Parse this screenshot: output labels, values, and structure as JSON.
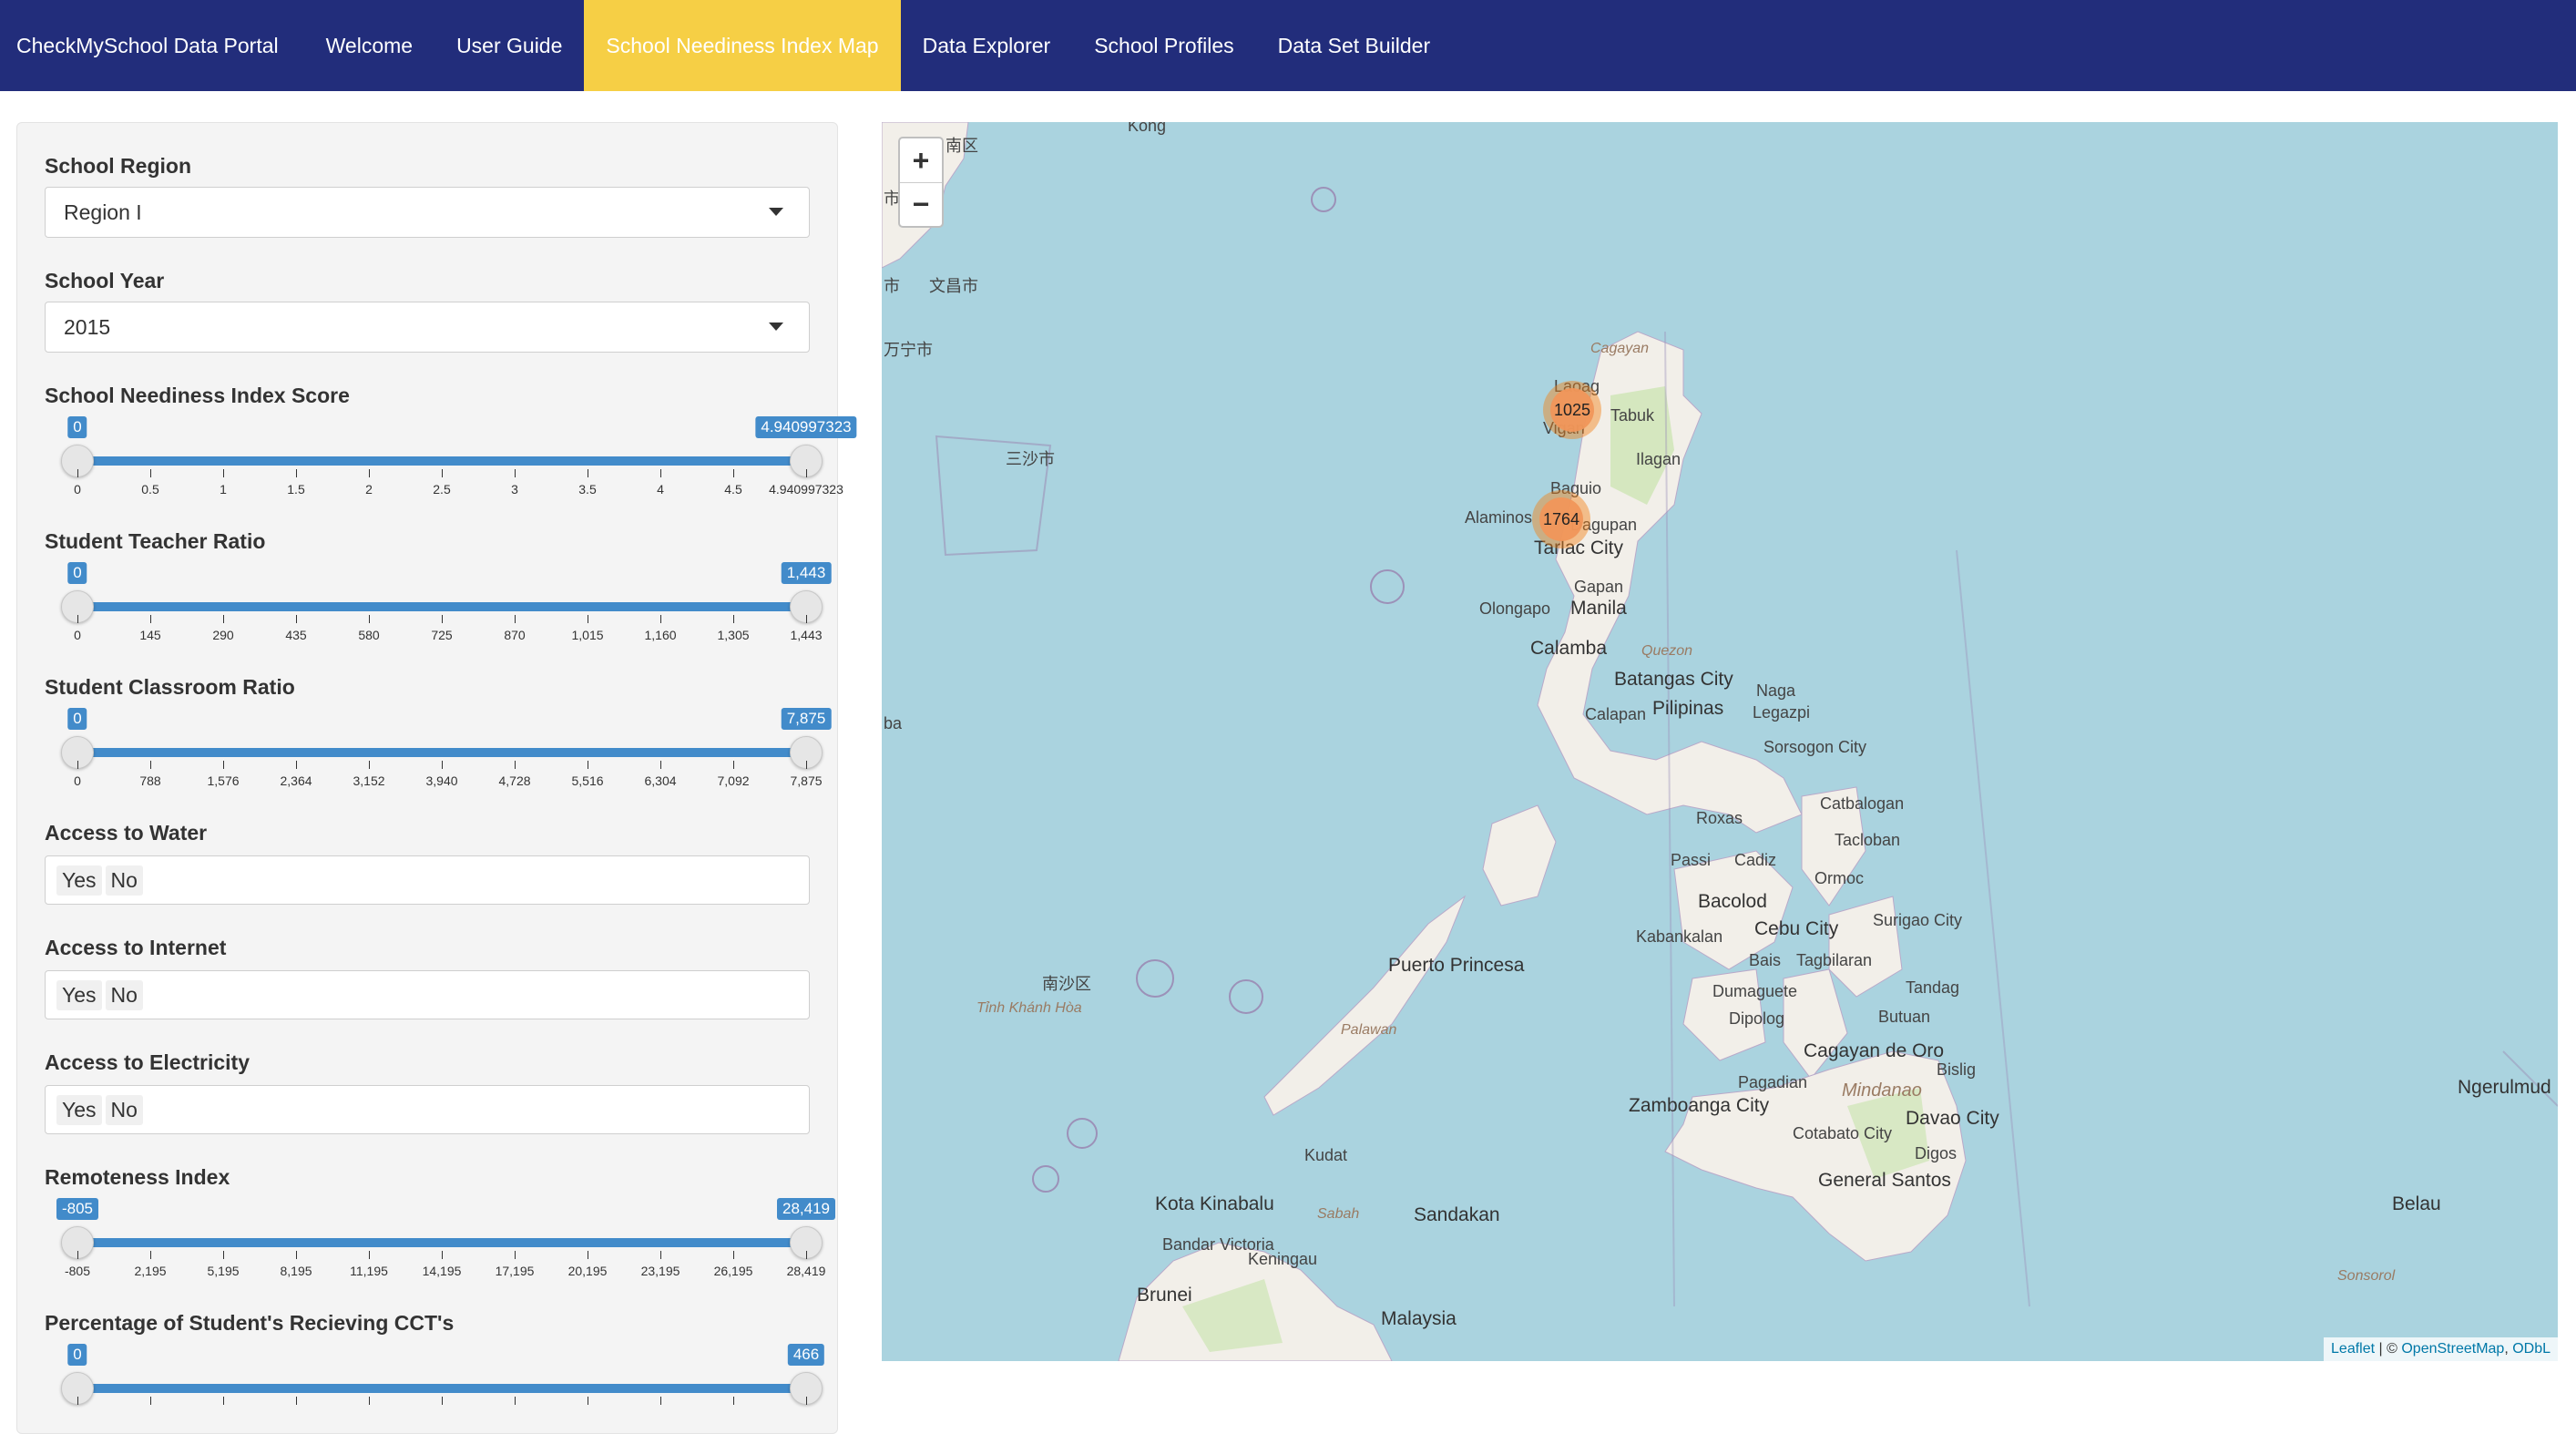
{
  "nav": {
    "brand": "CheckMySchool Data Portal",
    "tabs": [
      "Welcome",
      "User Guide",
      "School Neediness Index Map",
      "Data Explorer",
      "School Profiles",
      "Data Set Builder"
    ],
    "active_tab": "School Neediness Index Map",
    "colors": {
      "bar": "#222d7b",
      "active": "#f6cf45"
    }
  },
  "sidebar": {
    "region": {
      "label": "School Region",
      "value": "Region I"
    },
    "year": {
      "label": "School Year",
      "value": "2015"
    },
    "neediness": {
      "label": "School Neediness Index Score",
      "min": "0",
      "max": "4.940997323",
      "ticks": [
        "0",
        "0.5",
        "1",
        "1.5",
        "2",
        "2.5",
        "3",
        "3.5",
        "4",
        "4.5",
        "4.940997323"
      ]
    },
    "str": {
      "label": "Student Teacher Ratio",
      "min": "0",
      "max": "1,443",
      "ticks": [
        "0",
        "145",
        "290",
        "435",
        "580",
        "725",
        "870",
        "1,015",
        "1,160",
        "1,305",
        "1,443"
      ]
    },
    "scr": {
      "label": "Student Classroom Ratio",
      "min": "0",
      "max": "7,875",
      "ticks": [
        "0",
        "788",
        "1,576",
        "2,364",
        "3,152",
        "3,940",
        "4,728",
        "5,516",
        "6,304",
        "7,092",
        "7,875"
      ]
    },
    "water": {
      "label": "Access to Water",
      "options": [
        "Yes",
        "No"
      ]
    },
    "internet": {
      "label": "Access to Internet",
      "options": [
        "Yes",
        "No"
      ]
    },
    "electricity": {
      "label": "Access to Electricity",
      "options": [
        "Yes",
        "No"
      ]
    },
    "remoteness": {
      "label": "Remoteness Index",
      "min": "-805",
      "max": "28,419",
      "ticks": [
        "-805",
        "2,195",
        "5,195",
        "8,195",
        "11,195",
        "14,195",
        "17,195",
        "20,195",
        "23,195",
        "26,195",
        "28,419"
      ]
    },
    "cct": {
      "label": "Percentage of Student's Recieving CCT's",
      "min": "0",
      "max": "466"
    }
  },
  "map": {
    "zoom_in": "+",
    "zoom_out": "−",
    "clusters": [
      "1025",
      "1764"
    ],
    "places": {
      "kong": "Kong",
      "nanqu": "南区",
      "wenchang": "文昌市",
      "shi": "市",
      "shi2": "市",
      "wanning": "万宁市",
      "sansha": "三沙市",
      "cagayan": "Cagayan",
      "laoag": "Laoag",
      "vigan": "Vigan",
      "tabuk": "Tabuk",
      "ilagan": "Ilagan",
      "baguio": "Baguio",
      "alaminos": "Alaminos",
      "dagupan": "Dagupan",
      "tarlac": "Tarlac City",
      "gapan": "Gapan",
      "olongapo": "Olongapo",
      "manila": "Manila",
      "calamba": "Calamba",
      "quezon": "Quezon",
      "batangas": "Batangas City",
      "naga": "Naga",
      "legazpi": "Legazpi",
      "calapan": "Calapan",
      "pilipinas": "Pilipinas",
      "sorsogon": "Sorsogon City",
      "catbalogan": "Catbalogan",
      "tacloban": "Tacloban",
      "roxas": "Roxas",
      "ormoc": "Ormoc",
      "passi": "Passi",
      "cadiz": "Cadiz",
      "bacolod": "Bacolod",
      "cebu": "Cebu City",
      "surigao": "Surigao City",
      "kabankalan": "Kabankalan",
      "bais": "Bais",
      "tagbilaran": "Tagbilaran",
      "tandag": "Tandag",
      "dumaguete": "Dumaguete",
      "dipolog": "Dipolog",
      "butuan": "Butuan",
      "cagayandeoro": "Cagayan de Oro",
      "bislig": "Bislig",
      "pagadian": "Pagadian",
      "mindanao": "Mindanao",
      "zamboanga": "Zamboanga City",
      "davao": "Davao City",
      "cotabato": "Cotabato City",
      "digos": "Digos",
      "gensan": "General Santos",
      "puerto": "Puerto Princesa",
      "palawan": "Palawan",
      "nansha": "南沙区",
      "tinhkhanh": "Tỉnh Khánh Hòa",
      "kudat": "Kudat",
      "kotakinabalu": "Kota Kinabalu",
      "sabah": "Sabah",
      "sandakan": "Sandakan",
      "bandar": "Bandar Victoria",
      "keningau": "Keningau",
      "brunei": "Brunei",
      "malaysia": "Malaysia",
      "ba": "ba",
      "ngerulmud": "Ngerulmud",
      "belau": "Belau",
      "sonsorol": "Sonsorol"
    },
    "attribution": {
      "leaflet": "Leaflet",
      "sep": " | © ",
      "osm": "OpenStreetMap",
      "comma": ", ",
      "odbl": "ODbL"
    }
  }
}
